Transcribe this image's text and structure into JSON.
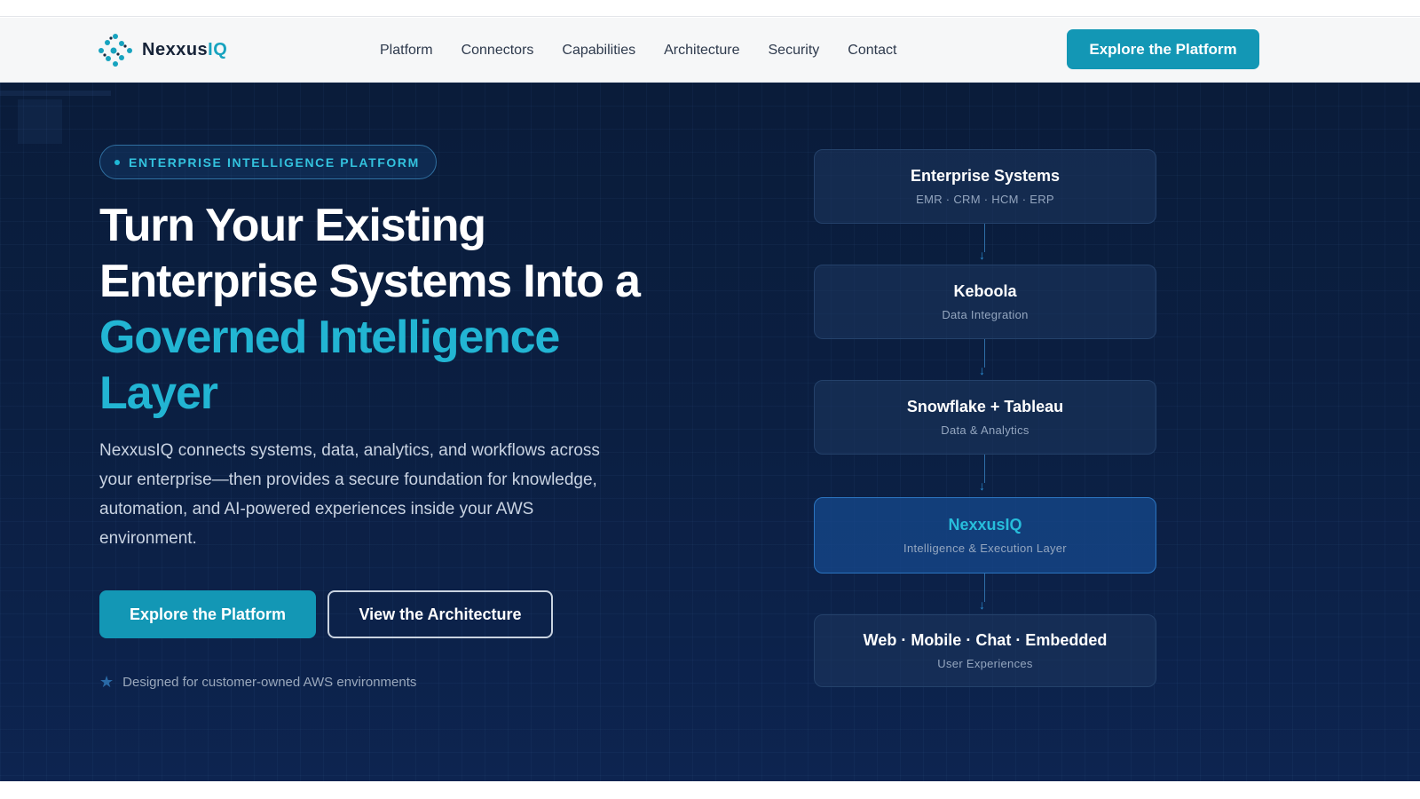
{
  "brand": {
    "name_main": "Nexxus",
    "name_accent": "IQ"
  },
  "nav": {
    "links": [
      "Platform",
      "Connectors",
      "Capabilities",
      "Architecture",
      "Security",
      "Contact"
    ],
    "cta": "Explore the Platform"
  },
  "hero": {
    "badge": "ENTERPRISE INTELLIGENCE PLATFORM",
    "headline_line1": "Turn Your Existing",
    "headline_line2": "Enterprise Systems Into a",
    "headline_accent1": "Governed Intelligence",
    "headline_accent2": "Layer",
    "lead": "NexxusIQ connects systems, data, analytics, and workflows across your enterprise—then provides a secure foundation for knowledge, automation, and AI-powered experiences inside your AWS environment.",
    "primary_button": "Explore the Platform",
    "secondary_button": "View the Architecture",
    "note": "Designed for customer-owned AWS environments"
  },
  "architecture": {
    "layers": [
      {
        "title": "Enterprise Systems",
        "subtitle": "EMR · CRM · HCM · ERP"
      },
      {
        "title": "Keboola",
        "subtitle": "Data Integration"
      },
      {
        "title": "Snowflake + Tableau",
        "subtitle": "Data & Analytics"
      },
      {
        "title": "NexxusIQ",
        "subtitle": "Intelligence & Execution Layer"
      },
      {
        "title": "Web · Mobile · Chat · Embedded",
        "subtitle": "User Experiences"
      }
    ],
    "arrow_glyph": "↓"
  },
  "colors": {
    "accent": "#1397b5",
    "accent_text": "#22b5d3",
    "hero_bg": "#0b1f42",
    "nav_bg": "#f6f7f8"
  },
  "icons": {
    "logo": "network-nodes-icon",
    "note": "star-icon",
    "arrow": "arrow-down-icon"
  }
}
